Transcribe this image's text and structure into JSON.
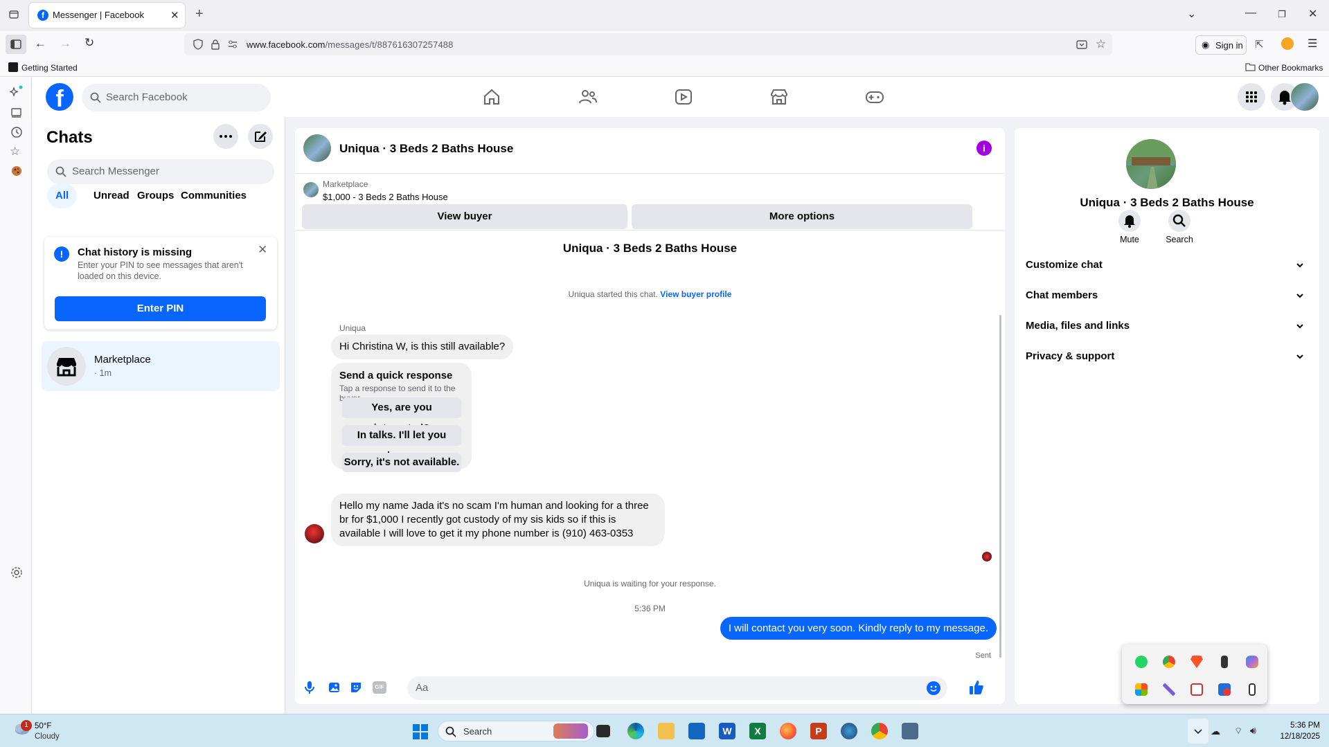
{
  "browser": {
    "tab_title": "Messenger | Facebook",
    "url_domain": "www.facebook.com",
    "url_path": "/messages/t/887616307257488",
    "sign_in": "Sign in",
    "bookmark_getting_started": "Getting Started",
    "other_bookmarks": "Other Bookmarks"
  },
  "fb": {
    "search_placeholder": "Search Facebook"
  },
  "chats": {
    "title": "Chats",
    "search_placeholder": "Search Messenger",
    "filters": [
      "All",
      "Unread",
      "Groups",
      "Communities"
    ],
    "warning_title": "Chat history is missing",
    "warning_body": "Enter your PIN to see messages that aren't loaded on this device.",
    "enter_pin": "Enter PIN",
    "marketplace_name": "Marketplace",
    "marketplace_time": "· 1m"
  },
  "conversation": {
    "header_title": "Uniqua · 3 Beds 2 Baths House",
    "listing_source": "Marketplace",
    "listing_title": "$1,000 - 3 Beds 2 Baths House",
    "view_buyer": "View buyer",
    "more_options": "More options",
    "thread_title": "Uniqua · 3 Beds 2 Baths House",
    "started_text": "Uniqua started this chat.",
    "view_buyer_profile": "View buyer profile",
    "sender_name": "Uniqua",
    "msg1": "Hi Christina W, is this still available?",
    "quick_title": "Send a quick response",
    "quick_sub": "Tap a response to send it to the buyer.",
    "quick_options": [
      "Yes, are you interested?",
      "In talks. I'll let you know.",
      "Sorry, it's not available."
    ],
    "msg2": "Hello my name Jada it's no scam I'm human and looking for a three br for $1,000 I recently got custody of my sis kids so if this is available I will love to get it my phone number is (910) 463-0353",
    "waiting": "Uniqua is waiting for your response.",
    "time": "5:36 PM",
    "my_msg": "I will contact you very soon. Kindly reply to my message.",
    "sent": "Sent",
    "composer_placeholder": "Aa"
  },
  "info": {
    "name": "Uniqua · 3 Beds 2 Baths House",
    "mute": "Mute",
    "search": "Search",
    "sections": [
      "Customize chat",
      "Chat members",
      "Media, files and links",
      "Privacy & support"
    ]
  },
  "taskbar": {
    "temp": "50°F",
    "weather": "Cloudy",
    "badge": "1",
    "search": "Search",
    "clock_time": "5:36 PM",
    "clock_date": "12/18/2025"
  },
  "colors": {
    "fb_blue": "#0866ff",
    "bubble_grey": "#f0f0f0",
    "info_purple": "#a200e0"
  }
}
